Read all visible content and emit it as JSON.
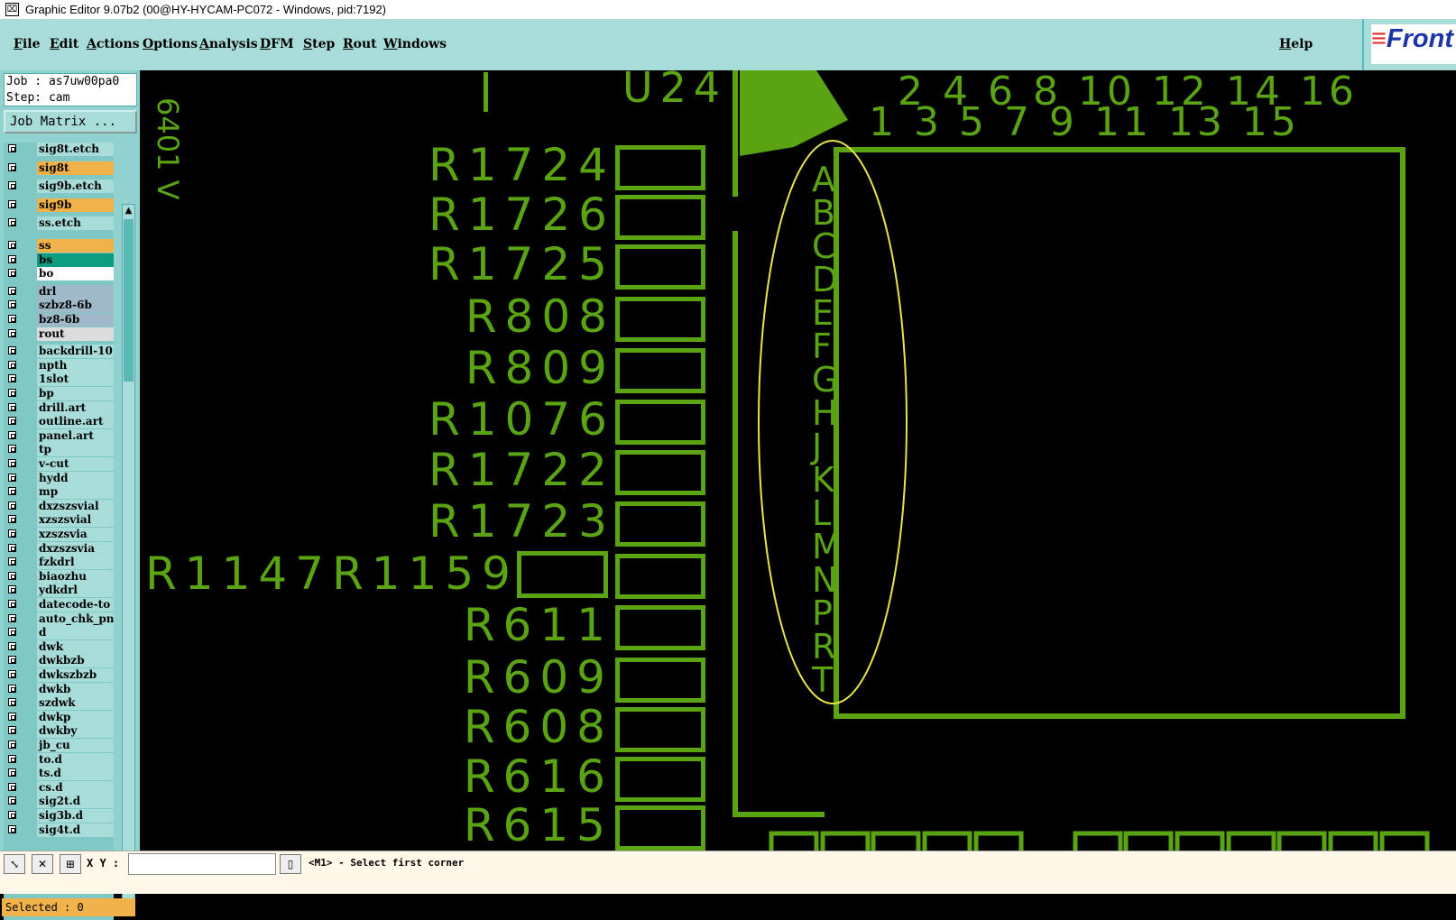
{
  "window": {
    "title": "Graphic Editor 9.07b2 (00@HY-HYCAM-PC072 - Windows, pid:7192)"
  },
  "menu": {
    "items": [
      "File",
      "Edit",
      "Actions",
      "Options",
      "Analysis",
      "DFM",
      "Step",
      "Rout",
      "Windows"
    ],
    "help": "Help",
    "logo": "Front"
  },
  "sidebar": {
    "job_line": "Job : as7uw00pa0",
    "step_line": "Step: cam",
    "job_matrix": "Job Matrix ...",
    "layers": [
      {
        "name": "sig8t.etch",
        "color": "#a8dcd9"
      },
      {
        "name": "sig8t",
        "color": "#f2b24a"
      },
      {
        "name": "sig9b.etch",
        "color": "#a8dcd9"
      },
      {
        "name": "sig9b",
        "color": "#f2b24a"
      },
      {
        "name": "ss.etch",
        "color": "#a8dcd9"
      },
      {
        "name": "ss",
        "color": "#f2b24a"
      },
      {
        "name": "bs",
        "color": "#0d9c80"
      },
      {
        "name": "bo",
        "color": "#ffffff"
      },
      {
        "name": "drl",
        "color": "#9fb9c8"
      },
      {
        "name": "szbz8-6b",
        "color": "#9fb9c8"
      },
      {
        "name": "bz8-6b",
        "color": "#9fb9c8"
      },
      {
        "name": "rout",
        "color": "#dcdcdc"
      },
      {
        "name": "backdrill-10",
        "color": "#a8dcd9"
      },
      {
        "name": "npth",
        "color": "#a8dcd9"
      },
      {
        "name": "1slot",
        "color": "#a8dcd9"
      },
      {
        "name": "bp",
        "color": "#a8dcd9"
      },
      {
        "name": "drill.art",
        "color": "#a8dcd9"
      },
      {
        "name": "outline.art",
        "color": "#a8dcd9"
      },
      {
        "name": "panel.art",
        "color": "#a8dcd9"
      },
      {
        "name": "tp",
        "color": "#a8dcd9"
      },
      {
        "name": "v-cut",
        "color": "#a8dcd9"
      },
      {
        "name": "hydd",
        "color": "#a8dcd9"
      },
      {
        "name": "mp",
        "color": "#a8dcd9"
      },
      {
        "name": "dxzszsvial",
        "color": "#a8dcd9"
      },
      {
        "name": "xzszsvial",
        "color": "#a8dcd9"
      },
      {
        "name": "xzszsvia",
        "color": "#a8dcd9"
      },
      {
        "name": "dxzszsvia",
        "color": "#a8dcd9"
      },
      {
        "name": "fzkdrl",
        "color": "#a8dcd9"
      },
      {
        "name": "biaozhu",
        "color": "#a8dcd9"
      },
      {
        "name": "ydkdrl",
        "color": "#a8dcd9"
      },
      {
        "name": "datecode-to",
        "color": "#a8dcd9"
      },
      {
        "name": "auto_chk_pnl",
        "color": "#a8dcd9"
      },
      {
        "name": "d",
        "color": "#a8dcd9"
      },
      {
        "name": "dwk",
        "color": "#a8dcd9"
      },
      {
        "name": "dwkbzb",
        "color": "#a8dcd9"
      },
      {
        "name": "dwkszbzb",
        "color": "#a8dcd9"
      },
      {
        "name": "dwkb",
        "color": "#a8dcd9"
      },
      {
        "name": "szdwk",
        "color": "#a8dcd9"
      },
      {
        "name": "dwkp",
        "color": "#a8dcd9"
      },
      {
        "name": "dwkby",
        "color": "#a8dcd9"
      },
      {
        "name": "jb_cu",
        "color": "#a8dcd9"
      },
      {
        "name": "to.d",
        "color": "#a8dcd9"
      },
      {
        "name": "ts.d",
        "color": "#a8dcd9"
      },
      {
        "name": "cs.d",
        "color": "#a8dcd9"
      },
      {
        "name": "sig2t.d",
        "color": "#a8dcd9"
      },
      {
        "name": "sig3b.d",
        "color": "#a8dcd9"
      },
      {
        "name": "sig4t.d",
        "color": "#a8dcd9"
      }
    ],
    "selected": "Selected : 0"
  },
  "status": {
    "xy_label": "X Y :",
    "message": "<M1> - Select first corner"
  },
  "canvas": {
    "component_label": "U24",
    "side_text": "6401 V",
    "refdes": [
      "R1724",
      "R1726",
      "R1725",
      "R808",
      "R809",
      "R1076",
      "R1722",
      "R1723",
      "R1147R1159",
      "R611",
      "R609",
      "R608",
      "R616",
      "R615"
    ],
    "col_numbers_top": "2 4 6 8 10 12 14 16",
    "col_numbers_bottom": "1 3 5 7 9 11 13 15",
    "row_letters": [
      "A",
      "B",
      "C",
      "D",
      "E",
      "F",
      "G",
      "H",
      "J",
      "K",
      "L",
      "M",
      "N",
      "P",
      "R",
      "T"
    ],
    "trace_color": "#5aa312",
    "highlight_color": "#e6e64a"
  }
}
